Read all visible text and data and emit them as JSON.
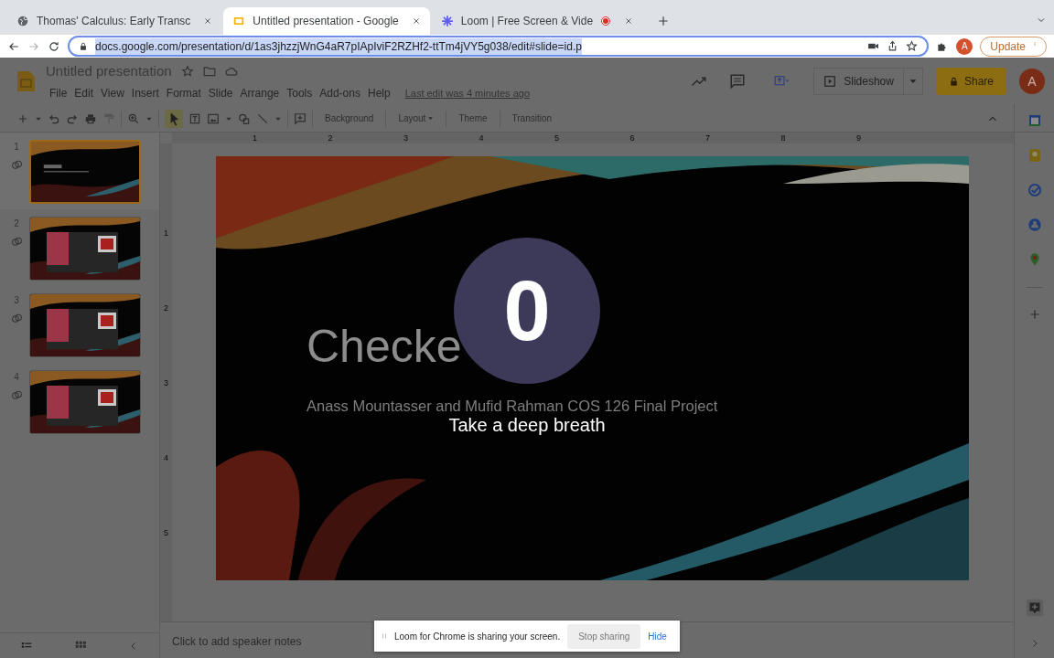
{
  "browser": {
    "tabs": [
      {
        "title": "Thomas' Calculus: Early Transc",
        "selected": false,
        "recording": false
      },
      {
        "title": "Untitled presentation - Google",
        "selected": true,
        "recording": false
      },
      {
        "title": "Loom | Free Screen & Vide",
        "selected": false,
        "recording": true
      }
    ],
    "address": "docs.google.com/presentation/d/1as3jhzzjWnG4aR7pIApIviF2RZHf2-ttTm4jVY5g038/edit#slide=id.p",
    "profile": "A",
    "update_button": "Update"
  },
  "app": {
    "title": "Untitled presentation",
    "menu": [
      "File",
      "Edit",
      "View",
      "Insert",
      "Format",
      "Slide",
      "Arrange",
      "Tools",
      "Add-ons",
      "Help"
    ],
    "last_edit": "Last edit was 4 minutes ago",
    "slideshow_button": "Slideshow",
    "share_button": "Share",
    "avatar": "A",
    "toolbar_buttons": [
      {
        "label": "Background",
        "dropdown": false
      },
      {
        "label": "Layout",
        "dropdown": true
      },
      {
        "label": "Theme",
        "dropdown": false
      },
      {
        "label": "Transition",
        "dropdown": false
      }
    ]
  },
  "rulers": {
    "horizontal": [
      "1",
      "2",
      "3",
      "4",
      "5",
      "6",
      "7",
      "8",
      "9"
    ],
    "vertical": [
      "1",
      "2",
      "3",
      "4",
      "5"
    ]
  },
  "slides": [
    {
      "number": "1",
      "selected": true
    },
    {
      "number": "2",
      "selected": false
    },
    {
      "number": "3",
      "selected": false
    },
    {
      "number": "4",
      "selected": false
    }
  ],
  "slide": {
    "title": "Checke",
    "subtitle": "Anass Mountasser and Mufid Rahman COS 126 Final Project"
  },
  "countdown": {
    "number": "0",
    "message": "Take a deep breath"
  },
  "notes_placeholder": "Click to add speaker notes",
  "loom_bar": {
    "message": "Loom for Chrome is sharing your screen.",
    "stop_button": "Stop sharing",
    "hide_link": "Hide"
  }
}
